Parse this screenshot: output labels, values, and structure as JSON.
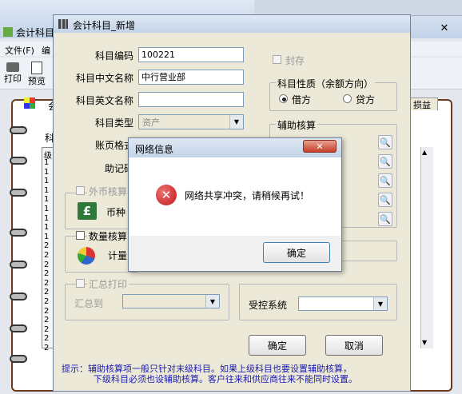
{
  "main_window": {
    "title": "会计科目",
    "menu_file": "文件(F)",
    "menu_edit": "编",
    "toolbar_print": "打印",
    "toolbar_preview": "预览",
    "right_tab": "损益",
    "table_header_partial": "科",
    "grid_row_numbers": [
      "1",
      "1",
      "1",
      "1",
      "1",
      "1",
      "1",
      "1",
      "1",
      "2",
      "2",
      "2",
      "2",
      "2",
      "2",
      "2",
      "2",
      "2",
      "2",
      "2",
      "2"
    ],
    "grid_col_partial": "级"
  },
  "dialog": {
    "title": "会计科目_新增",
    "code_label": "科目编码",
    "code_value": "100221",
    "name_cn_label": "科目中文名称",
    "name_cn_value": "中行营业部",
    "name_en_label": "科目英文名称",
    "name_en_value": "",
    "type_label": "科目类型",
    "type_value": "资产",
    "page_format_label": "账页格式",
    "mnemonic_label": "助记码",
    "sealed_label": "封存",
    "nature_group_title": "科目性质（余额方向）",
    "debit_label": "借方",
    "credit_label": "贷方",
    "aux_group_title": "辅助核算",
    "foreign_currency_label": "外币核算",
    "currency_label": "币种",
    "quantity_label": "数量核算",
    "unit_label": "计量",
    "summary_print_label": "汇总打印",
    "summary_to_label": "汇总到",
    "controlled_system_label": "受控系统",
    "ok_label": "确定",
    "cancel_label": "取消",
    "hint_line1": "提示：辅助核算项一般只针对末级科目。如果上级科目也要设置辅助核算，",
    "hint_line2": "下级科目必须也设辅助核算。客户往来和供应商往来不能同时设置。"
  },
  "message_box": {
    "title": "网络信息",
    "message": "网络共享冲突，请稍候再试！",
    "ok_label": "确定",
    "close_glyph": "✕"
  },
  "colors": {
    "hint_text": "#1a1ab0",
    "error_icon": "#d21f1f"
  }
}
